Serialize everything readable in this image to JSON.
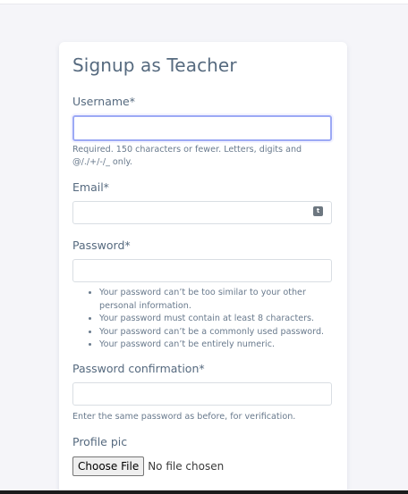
{
  "form": {
    "title": "Signup as Teacher",
    "username": {
      "label": "Username*",
      "value": "",
      "help": "Required. 150 characters or fewer. Letters, digits and @/./+/-/_ only."
    },
    "email": {
      "label": "Email*",
      "value": "",
      "icon": "password-manager-icon",
      "icon_glyph": "t"
    },
    "password": {
      "label": "Password*",
      "value": "",
      "rules": [
        "Your password can’t be too similar to your other personal information.",
        "Your password must contain at least 8 characters.",
        "Your password can’t be a commonly used password.",
        "Your password can’t be entirely numeric."
      ]
    },
    "password_confirmation": {
      "label": "Password confirmation*",
      "value": "",
      "help": "Enter the same password as before, for verification."
    },
    "profile_pic": {
      "label": "Profile pic",
      "button_label": "Choose File",
      "status": "No file chosen"
    }
  },
  "colors": {
    "background": "#f5f5f9",
    "card": "#ffffff",
    "text": "#566a7f",
    "focus_border": "#9ca9f5"
  }
}
